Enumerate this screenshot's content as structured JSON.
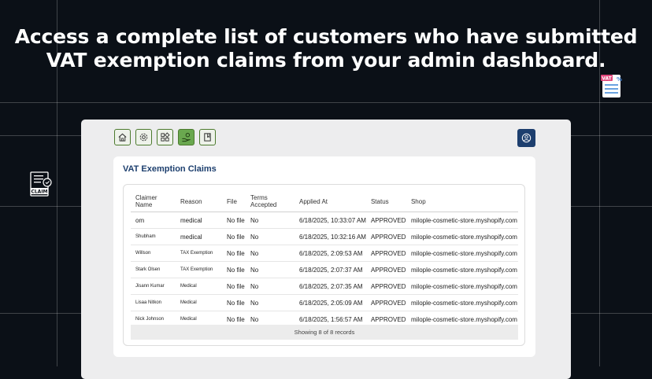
{
  "headline": {
    "line1": "Access a complete list of customers who have submitted",
    "line2": "VAT exemption claims from your admin dashboard."
  },
  "badges": {
    "vat_text": "VAT",
    "claim_text": "CLAIM"
  },
  "colors": {
    "navy": "#1d3f6e",
    "green": "#6aa84f",
    "green_border": "#4c7a2e",
    "background": "#0b1017"
  },
  "toolbar": {
    "buttons": [
      {
        "icon": "home-icon"
      },
      {
        "icon": "gear-icon"
      },
      {
        "icon": "grid-icon"
      },
      {
        "icon": "hand-money-icon",
        "active": true
      },
      {
        "icon": "book-icon"
      }
    ],
    "profile_icon": "user-icon"
  },
  "card": {
    "title": "VAT Exemption Claims",
    "columns": [
      "Claimer Name",
      "Reason",
      "File",
      "Terms Accepted",
      "Applied At",
      "Status",
      "Shop"
    ],
    "rows": [
      {
        "name": "om",
        "reason": "medical",
        "file": "No file",
        "terms": "No",
        "applied": "6/18/2025, 10:33:07 AM",
        "status": "APPROVED",
        "shop": "milople-cosmetic-store.myshopify.com"
      },
      {
        "name": "Shubham",
        "reason": "medical",
        "file": "No file",
        "terms": "No",
        "applied": "6/18/2025, 10:32:16 AM",
        "status": "APPROVED",
        "shop": "milople-cosmetic-store.myshopify.com"
      },
      {
        "name": "Willson",
        "reason": "TAX Exemption",
        "file": "No file",
        "terms": "No",
        "applied": "6/18/2025, 2:09:53 AM",
        "status": "APPROVED",
        "shop": "milople-cosmetic-store.myshopify.com"
      },
      {
        "name": "Stark Olsen",
        "reason": "TAX Exemption",
        "file": "No file",
        "terms": "No",
        "applied": "6/18/2025, 2:07:37 AM",
        "status": "APPROVED",
        "shop": "milople-cosmetic-store.myshopify.com"
      },
      {
        "name": "Jisann Kumar",
        "reason": "Medical",
        "file": "No file",
        "terms": "No",
        "applied": "6/18/2025, 2:07:35 AM",
        "status": "APPROVED",
        "shop": "milople-cosmetic-store.myshopify.com"
      },
      {
        "name": "Lisaa Nitkon",
        "reason": "Medical",
        "file": "No file",
        "terms": "No",
        "applied": "6/18/2025, 2:05:09 AM",
        "status": "APPROVED",
        "shop": "milople-cosmetic-store.myshopify.com"
      },
      {
        "name": "Nick Johnson",
        "reason": "Medical",
        "file": "No file",
        "terms": "No",
        "applied": "6/18/2025, 1:56:57 AM",
        "status": "APPROVED",
        "shop": "milople-cosmetic-store.myshopify.com"
      }
    ],
    "footer": "Showing 8 of 8 records"
  }
}
